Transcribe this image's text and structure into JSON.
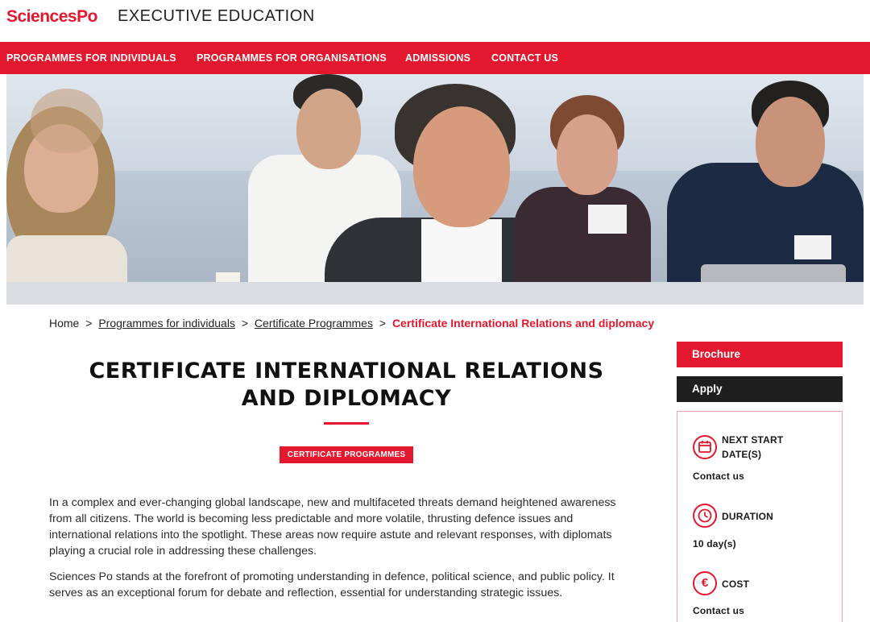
{
  "header": {
    "logo": "SciencesPo",
    "site_title": "EXECUTIVE EDUCATION"
  },
  "nav": {
    "items": [
      {
        "label": "PROGRAMMES FOR INDIVIDUALS"
      },
      {
        "label": "PROGRAMMES FOR ORGANISATIONS"
      },
      {
        "label": "ADMISSIONS"
      },
      {
        "label": "CONTACT US"
      }
    ]
  },
  "breadcrumb": {
    "home": "Home",
    "sep": ">",
    "level1": "Programmes for individuals",
    "level2": "Certificate Programmes",
    "current": "Certificate International Relations and diplomacy"
  },
  "main": {
    "title_line1": "CERTIFICATE INTERNATIONAL RELATIONS",
    "title_line2": "AND DIPLOMACY",
    "tag": "CERTIFICATE PROGRAMMES",
    "paragraphs": [
      "In a complex and ever-changing global landscape, new and multifaceted threats demand heightened awareness from all citizens. The world is becoming less predictable and more volatile, thrusting defence issues and international relations into the spotlight. These areas now require astute and relevant responses, with diplomats playing a crucial role in addressing these challenges.",
      "Sciences Po stands at the forefront of promoting understanding in defence, political science, and public policy. It serves as an exceptional forum for debate and reflection, essential for understanding strategic issues."
    ]
  },
  "sidebar": {
    "brochure_label": "Brochure",
    "apply_label": "Apply",
    "info": [
      {
        "icon": "calendar-icon",
        "label_line1": "NEXT START",
        "label_line2": "DATE(S)",
        "value": "Contact us"
      },
      {
        "icon": "clock-icon",
        "label_line1": "DURATION",
        "label_line2": "",
        "value": "10 day(s)"
      },
      {
        "icon": "euro-icon",
        "symbol": "€",
        "label_line1": "COST",
        "label_line2": "",
        "value": "Contact us"
      }
    ]
  },
  "colors": {
    "brand_red": "#e3172d",
    "apply_dark": "#1f1f1f"
  }
}
